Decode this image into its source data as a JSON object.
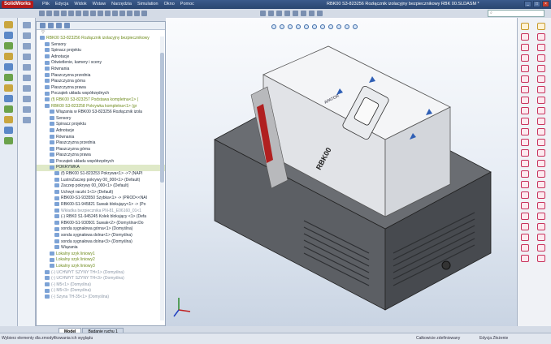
{
  "app": {
    "logo": "SolidWorks",
    "document_title": "RBK00 S3-823256 Rozłącznik izolacyjny bezpiecznikowy RBK 00.SLDASM *"
  },
  "menu": [
    "Plik",
    "Edycja",
    "Widok",
    "Wstaw",
    "Narzędzia",
    "Simulation",
    "Okno",
    "Pomoc"
  ],
  "tree": {
    "filter": "▽",
    "items": [
      {
        "label": "RBK00 S3-823256 Rozłącznik izolacyjny bezpiecznikowy",
        "style": "hl"
      },
      {
        "label": "Sensory",
        "style": ""
      },
      {
        "label": "Spinacz projektu",
        "style": ""
      },
      {
        "label": "Adnotacje",
        "style": ""
      },
      {
        "label": "Oświetlenie, kamery i sceny",
        "style": ""
      },
      {
        "label": "Równania",
        "style": ""
      },
      {
        "label": "Płaszczyzna przednia",
        "style": ""
      },
      {
        "label": "Płaszczyzna górna",
        "style": ""
      },
      {
        "label": "Płaszczyzna prawa",
        "style": ""
      },
      {
        "label": "Początek układu współrzędnych",
        "style": ""
      },
      {
        "label": "(f) RBK00 S3-823257 Podstawa kompletna<1> (",
        "style": "hl"
      },
      {
        "label": "RBK00 S3-823258 Pokrywka kompletna<1> (gr",
        "style": "hl"
      },
      {
        "label": "Wiązania w RBK00 S3-823256 Rozłącznik izola",
        "style": ""
      },
      {
        "label": "Sensory",
        "style": ""
      },
      {
        "label": "Spinacz projektu",
        "style": ""
      },
      {
        "label": "Adnotacje",
        "style": ""
      },
      {
        "label": "Równania",
        "style": ""
      },
      {
        "label": "Płaszczyzna przednia",
        "style": ""
      },
      {
        "label": "Płaszczyzna górna",
        "style": ""
      },
      {
        "label": "Płaszczyzna prawa",
        "style": ""
      },
      {
        "label": "Początek układu współrzędnych",
        "style": ""
      },
      {
        "label": "POKRYWKA",
        "style": "sel"
      },
      {
        "label": "(f) RBK00 S1-823253 Pokrywa<1> ->? (NAPI",
        "style": ""
      },
      {
        "label": "LustroZaczep pokrywy 00_000<1> (Default)",
        "style": ""
      },
      {
        "label": "Zaczep pokrywy 00_000<1> (Default)",
        "style": ""
      },
      {
        "label": "Uchwyt raczki 1<1> (Default)",
        "style": ""
      },
      {
        "label": "RBK00-S1-933550 Szybka<1> -> (PROD<<NAI",
        "style": ""
      },
      {
        "label": "RBK00-S1-945821 Suwak blokujący<1> -> (Po",
        "style": ""
      },
      {
        "label": "Wkładka bezpiecznika PN-81_E06160_01<1",
        "style": "gr"
      },
      {
        "label": "(-) RBK0 S1-945245 Kolek blokujący <1> (Defa",
        "style": ""
      },
      {
        "label": "RBK00-S1-930501 Suwak<2> (Domyślna<Do",
        "style": ""
      },
      {
        "label": "sonda sygnałowa górna<1> (Domyślna)",
        "style": ""
      },
      {
        "label": "sonda sygnałowa dolna<1> (Domyślna)",
        "style": ""
      },
      {
        "label": "sonda sygnałowa dolna<3> (Domyślna)",
        "style": ""
      },
      {
        "label": "Wiązania",
        "style": ""
      },
      {
        "label": "Lokalny szyk liniowy1",
        "style": "hl"
      },
      {
        "label": "Lokalny szyk liniowy2",
        "style": "hl"
      },
      {
        "label": "Lokalny szyk liniowy3",
        "style": "hl"
      },
      {
        "label": "(-) UCHWYT SZYNY TH<1> (Domyślna)",
        "style": "gr"
      },
      {
        "label": "(-) UCHWYT SZYNY TH<3> (Domyślna)",
        "style": "gr"
      },
      {
        "label": "(-) M5<1> (Domyślna)",
        "style": "gr"
      },
      {
        "label": "(-) M5<3> (Domyślna)",
        "style": "gr"
      },
      {
        "label": "(-) Szyna TH-35<1> (Domyślna)",
        "style": "gr"
      }
    ]
  },
  "model": {
    "brand": "APATOR",
    "label": "RBK00"
  },
  "bottom_tabs": [
    "Model",
    "Badanie ruchu 1"
  ],
  "status": {
    "hint": "Wybierz elementy dla zmodyfikowania ich wyglądu",
    "state": "Całkowicie zdefiniowany",
    "mode": "Edycja Złożenie"
  }
}
